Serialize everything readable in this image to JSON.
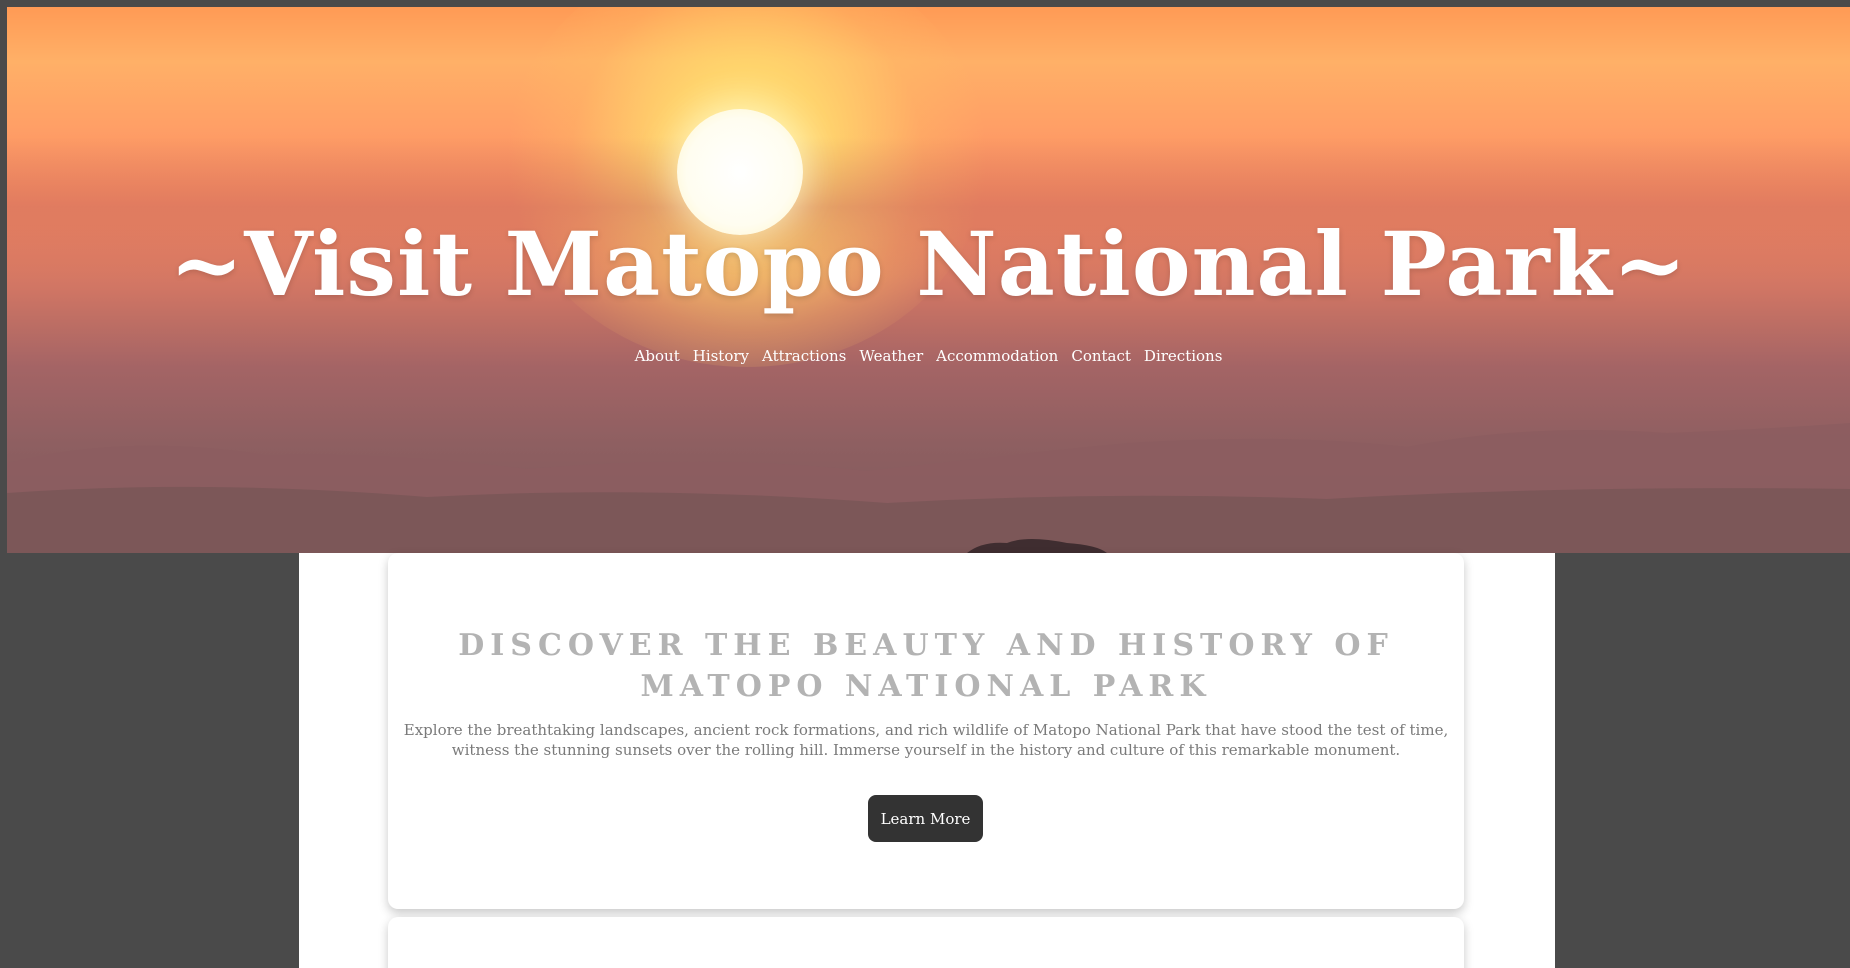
{
  "header": {
    "title": "~Visit Matopo National Park~"
  },
  "nav": {
    "items": [
      {
        "label": "About"
      },
      {
        "label": "History"
      },
      {
        "label": "Attractions"
      },
      {
        "label": "Weather"
      },
      {
        "label": "Accommodation"
      },
      {
        "label": "Contact"
      },
      {
        "label": "Directions"
      }
    ]
  },
  "intro": {
    "heading": "DISCOVER THE BEAUTY AND HISTORY OF MATOPO NATIONAL PARK",
    "text": "Explore the breathtaking landscapes, ancient rock formations, and rich wildlife of Matopo National Park that have stood the test of time, witness the stunning sunsets over the rolling hill. Immerse yourself in the history and culture of this remarkable monument.",
    "button_label": "Learn More"
  },
  "colors": {
    "page_background": "#4a4a4a",
    "button_background": "#333333",
    "heading_color": "#b3b3b3",
    "text_color": "#7a7a7a"
  }
}
